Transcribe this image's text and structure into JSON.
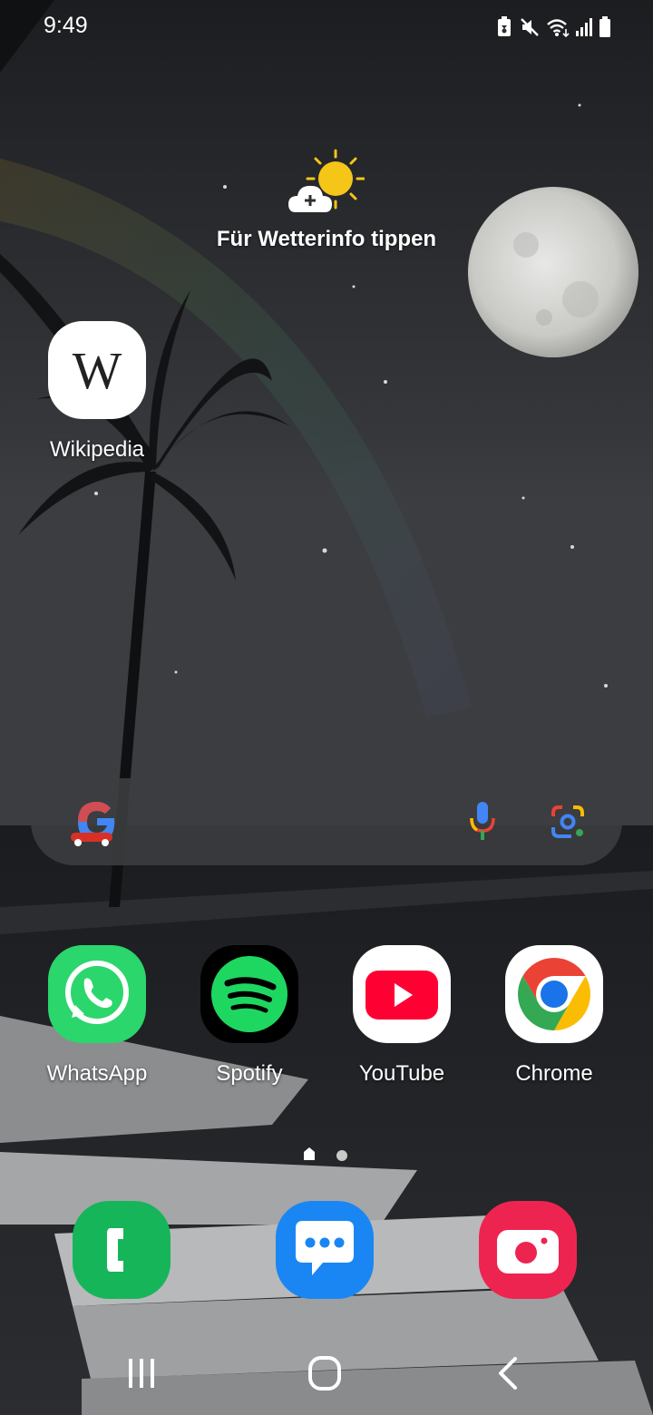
{
  "status_bar": {
    "time": "9:49",
    "icons": [
      "battery-saver-icon",
      "mute-icon",
      "wifi-icon",
      "signal-icon",
      "battery-icon"
    ]
  },
  "weather_widget": {
    "text": "Für Wetterinfo tippen",
    "icon": "sun-cloud-plus-icon"
  },
  "home_apps": [
    {
      "label": "Wikipedia",
      "icon": "wikipedia-icon"
    }
  ],
  "search_bar": {
    "icons": [
      "google-logo-icon",
      "microphone-icon",
      "google-lens-icon"
    ]
  },
  "apps_row": [
    {
      "label": "WhatsApp",
      "icon": "whatsapp-icon",
      "color": "#2bd66c"
    },
    {
      "label": "Spotify",
      "icon": "spotify-icon",
      "color": "#1ed760"
    },
    {
      "label": "YouTube",
      "icon": "youtube-icon",
      "color": "#ff0033"
    },
    {
      "label": "Chrome",
      "icon": "chrome-icon",
      "color": "#4285f4"
    }
  ],
  "page_indicator": {
    "pages": 2,
    "current": 1
  },
  "dock": [
    {
      "icon": "phone-icon",
      "color": "#17b55a"
    },
    {
      "icon": "messages-icon",
      "color": "#1a86f3"
    },
    {
      "icon": "camera-icon",
      "color": "#ee2450"
    }
  ],
  "nav_bar": {
    "buttons": [
      "recents-button",
      "home-button",
      "back-button"
    ]
  }
}
